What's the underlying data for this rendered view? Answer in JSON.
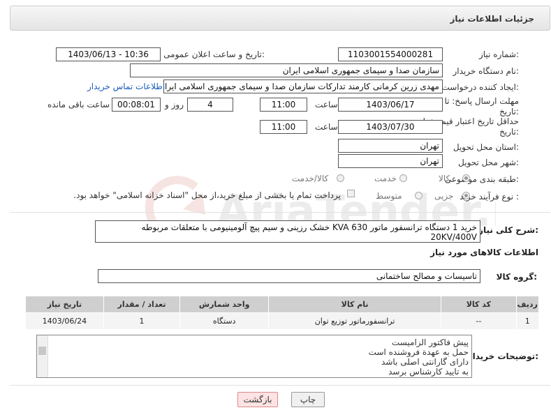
{
  "header": {
    "title": "جزئیات اطلاعات نیاز"
  },
  "fields": {
    "need_number_label": "شماره نیاز:",
    "need_number": "1103001554000281",
    "announce_label": "تاریخ و ساعت اعلان عمومی:",
    "announce_value": "1403/06/13 - 10:36",
    "buyer_org_label": "نام دستگاه خریدار:",
    "buyer_org": "سازمان صدا و سیمای جمهوری اسلامی ایران",
    "creator_label": "ایجاد کننده درخواست:",
    "creator": "مهدی زرین کرمانی کارمند تدارکات سازمان صدا و سیمای جمهوری اسلامی ایران",
    "contact_link": "اطلاعات تماس خریدار",
    "reply_deadline_label": "مهلت ارسال پاسخ: تا",
    "reply_deadline_label2": "تاریخ:",
    "reply_date": "1403/06/17",
    "time_label": "ساعت",
    "reply_time": "11:00",
    "days_value": "4",
    "days_label": "روز و",
    "remaining_value": "00:08:01",
    "remaining_label": "ساعت باقی مانده",
    "validity_label": "حداقل تاریخ اعتبار قیمت: تا",
    "validity_label2": "تاریخ:",
    "validity_date": "1403/07/30",
    "validity_time": "11:00",
    "province_label": "استان محل تحویل:",
    "province": "تهران",
    "city_label": "شهر محل تحویل:",
    "city": "تهران",
    "category_label": "طبقه بندی موضوعی:",
    "category_options": [
      "کالا",
      "خدمت",
      "کالا/خدمت"
    ],
    "purchase_type_label": "نوع فرآیند خرید :",
    "purchase_options": [
      "جزیی",
      "متوسط"
    ],
    "payment_note": "پرداخت تمام یا بخشی از مبلغ خرید،از محل \"اسناد خزانه اسلامی\" خواهد بود."
  },
  "description": {
    "label": "شرح کلی نیاز:",
    "text": "خرید 1 دستگاه ترانسفور ماتور KVA 630 خشک رزینی و سیم پیچ آلومینیومی با متعلقات مربوطه 20KV/400V"
  },
  "goods_section": {
    "title": "اطلاعات کالاهای مورد نیاز",
    "group_label": "گروه کالا:",
    "group_value": "تاسیسات و مصالح ساختمانی"
  },
  "table": {
    "headers": [
      "ردیف",
      "کد کالا",
      "نام کالا",
      "واحد شمارش",
      "تعداد / مقدار",
      "تاریخ نیاز"
    ],
    "rows": [
      [
        "1",
        "--",
        "ترانسفورماتور توزیع توان",
        "دستگاه",
        "1",
        "1403/06/24"
      ]
    ]
  },
  "buyer_notes": {
    "label": "توضیحات خریدار:",
    "lines": [
      "پیش فاکتور الزامیست",
      "حمل به عهدة فروشنده است",
      "دارای گارانتی اصلی باشد",
      "به تایید کارشناس برسد"
    ]
  },
  "buttons": {
    "print": "چاپ",
    "back": "بازگشت"
  },
  "watermark": {
    "text": "AriaTender.neT"
  }
}
